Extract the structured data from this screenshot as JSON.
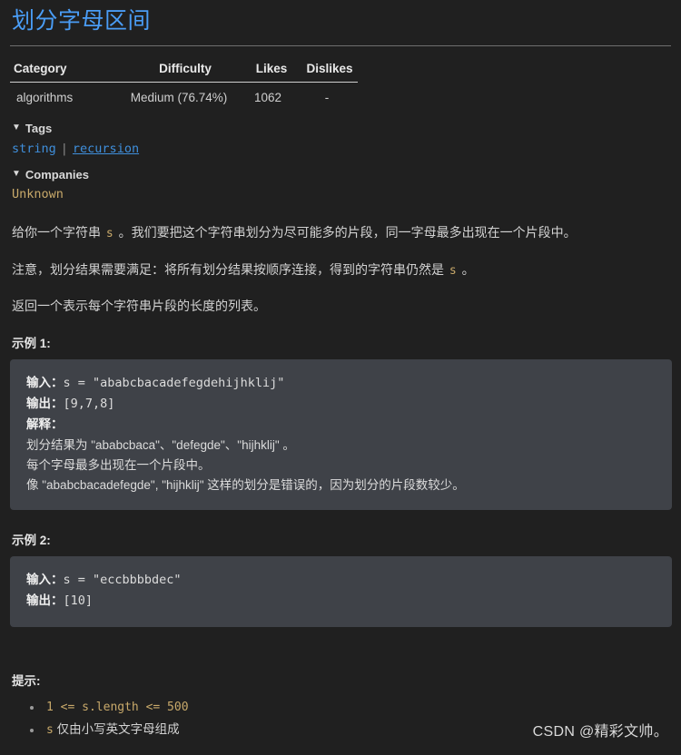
{
  "page": {
    "title": "划分字母区间",
    "bg_color": "#202020",
    "title_color": "#4a9df6"
  },
  "meta_table": {
    "headers": [
      "Category",
      "Difficulty",
      "Likes",
      "Dislikes"
    ],
    "row": {
      "category": "algorithms",
      "difficulty": "Medium (76.74%)",
      "likes": "1062",
      "dislikes": "-"
    }
  },
  "tags_section": {
    "marker": "▼",
    "heading": "Tags",
    "items": [
      "string",
      "recursion"
    ],
    "separator": "|"
  },
  "companies_section": {
    "marker": "▼",
    "heading": "Companies",
    "value": "Unknown",
    "value_color": "#c8a96a"
  },
  "description": {
    "p1_a": "给你一个字符串 ",
    "p1_code": "s",
    "p1_b": " 。我们要把这个字符串划分为尽可能多的片段，同一字母最多出现在一个片段中。",
    "p2_a": "注意，划分结果需要满足：将所有划分结果按顺序连接，得到的字符串仍然是 ",
    "p2_code": "s",
    "p2_b": " 。",
    "p3": "返回一个表示每个字符串片段的长度的列表。"
  },
  "examples": [
    {
      "title": "示例 1:",
      "lines": [
        {
          "label": "输入：",
          "value": "s = \"ababcbacadefegdehijhklij\""
        },
        {
          "label": "输出：",
          "value": "[9,7,8]"
        },
        {
          "label": "解释：",
          "value": ""
        },
        {
          "label": "",
          "value": "划分结果为 \"ababcbaca\"、\"defegde\"、\"hijhklij\" 。"
        },
        {
          "label": "",
          "value": "每个字母最多出现在一个片段中。"
        },
        {
          "label": "",
          "value": "像 \"ababcbacadefegde\", \"hijhklij\" 这样的划分是错误的，因为划分的片段数较少。"
        }
      ]
    },
    {
      "title": "示例 2:",
      "lines": [
        {
          "label": "输入：",
          "value": "s = \"eccbbbbdec\""
        },
        {
          "label": "输出：",
          "value": "[10]"
        }
      ]
    }
  ],
  "hints": {
    "title": "提示:",
    "items": [
      {
        "code": "1 <= s.length <= 500",
        "text": ""
      },
      {
        "code": "s",
        "text": " 仅由小写英文字母组成"
      }
    ]
  },
  "watermark": "CSDN @精彩文帅。"
}
